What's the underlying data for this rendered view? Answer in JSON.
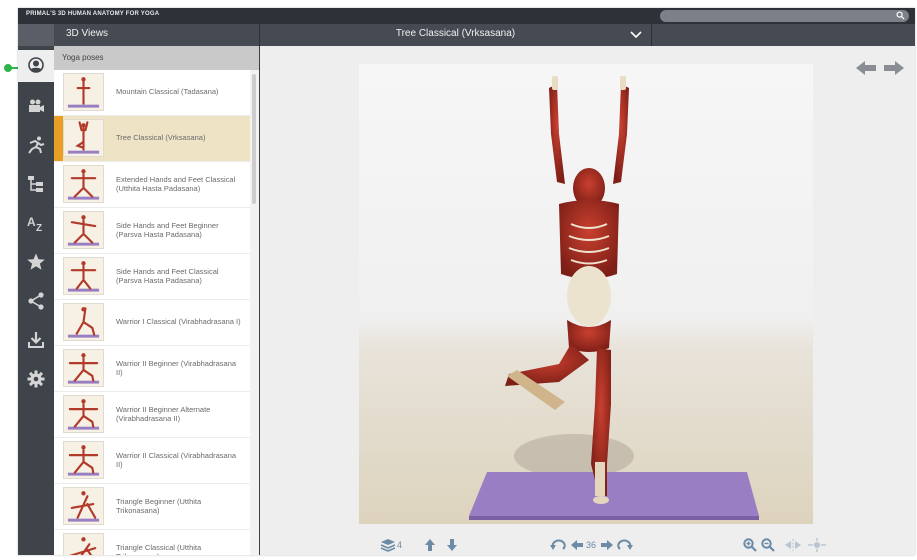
{
  "app": {
    "title": "PRIMAL'S 3D HUMAN ANATOMY FOR YOGA"
  },
  "search": {
    "placeholder": ""
  },
  "topbar": {
    "views_label": "3D Views",
    "current_pose": "Tree Classical (Vrksasana)"
  },
  "sidebar": {
    "icons": [
      "3d-views-icon",
      "video-camera-icon",
      "running-figure-icon",
      "hierarchy-icon",
      "a-z-icon",
      "star-icon",
      "share-icon",
      "download-icon",
      "settings-gear-icon"
    ],
    "active": "3d-views-icon"
  },
  "panel": {
    "header": "Yoga poses",
    "items": [
      {
        "label": "Mountain Classical (Tadasana)",
        "selected": false
      },
      {
        "label": "Tree Classical (Vrksasana)",
        "selected": true
      },
      {
        "label": "Extended Hands and Feet Classical (Utthita Hasta Padasana)",
        "selected": false
      },
      {
        "label": "Side Hands and Feet Beginner (Parsva Hasta Padasana)",
        "selected": false
      },
      {
        "label": "Side Hands and Feet Classical (Parsva Hasta Padasana)",
        "selected": false
      },
      {
        "label": "Warrior I Classical (Virabhadrasana I)",
        "selected": false
      },
      {
        "label": "Warrior II Beginner (Virabhadrasana II)",
        "selected": false
      },
      {
        "label": "Warrior II Beginner Alternate (Virabhadrasana II)",
        "selected": false
      },
      {
        "label": "Warrior II Classical (Virabhadrasana II)",
        "selected": false
      },
      {
        "label": "Triangle Beginner (Utthita Trikonasana)",
        "selected": false
      },
      {
        "label": "Triangle Classical (Utthita Trikonasana)",
        "selected": false
      }
    ]
  },
  "toolbar": {
    "layers_count": "4",
    "rotation_count": "36"
  },
  "colors": {
    "accent": "#e8a024",
    "selected_bg": "#efe3c5",
    "icon_blue": "#6b8ba6",
    "mat": "#9a7ec4"
  }
}
